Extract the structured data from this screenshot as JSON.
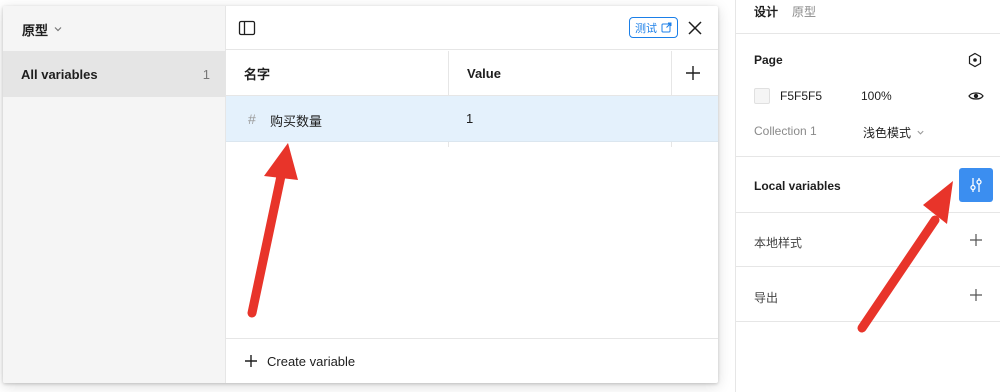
{
  "modal": {
    "collection_name": "原型",
    "group": {
      "name": "All variables",
      "count": "1"
    },
    "test_badge": "测试",
    "table": {
      "columns": [
        "名字",
        "Value"
      ],
      "rows": [
        {
          "icon": "#",
          "name": "购买数量",
          "value": "1"
        }
      ]
    },
    "create_variable_label": "Create variable"
  },
  "panel": {
    "tabs": [
      "设计",
      "原型"
    ],
    "page_title": "Page",
    "fill_hex": "F5F5F5",
    "fill_opacity": "100%",
    "collection_label": "Collection 1",
    "mode_label": "浅色模式",
    "local_variables_label": "Local variables",
    "local_styles_label": "本地样式",
    "export_label": "导出"
  },
  "colors": {
    "accent": "#3b8ef0",
    "selection_row": "#e4f1fc",
    "annotation_arrow": "#e8342a"
  }
}
